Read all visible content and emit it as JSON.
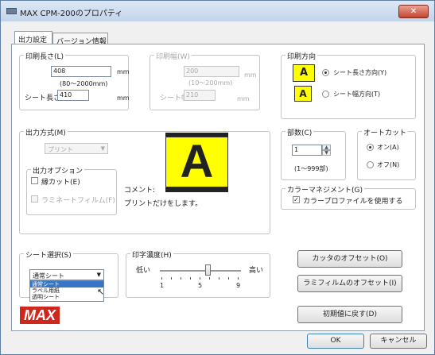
{
  "window": {
    "title": "MAX CPM-200のプロパティ",
    "close_glyph": "✕"
  },
  "tabs": [
    {
      "label": "出力設定",
      "active": true
    },
    {
      "label": "バージョン情報",
      "active": false
    }
  ],
  "print_length": {
    "label": "印刷長さ(L)",
    "value": "408",
    "unit": "mm",
    "range": "(80～2000mm)",
    "sheet_length_label": "シート長さ:",
    "sheet_length_value": "410",
    "sheet_length_unit": "mm"
  },
  "print_width": {
    "label": "印刷幅(W)",
    "value": "200",
    "unit": "mm",
    "range": "(10～200mm)",
    "sheet_width_label": "シート幅:",
    "sheet_width_value": "210",
    "sheet_width_unit": "mm"
  },
  "print_direction": {
    "label": "印刷方向",
    "option_length": "シート長さ方向(Y)",
    "option_width": "シート幅方向(T)",
    "selected": "length"
  },
  "output_method": {
    "label": "出力方式(M)",
    "select_value": "プリント",
    "options_label": "出力オプション",
    "border_cut_label": "縁カット(E)",
    "border_cut_checked": false,
    "laminate_label": "ラミネートフィルム(F)",
    "laminate_checked": false,
    "comment_label": "コメント:",
    "comment_text": "プリントだけをします。",
    "preview_letter": "A"
  },
  "copies": {
    "label": "部数(C)",
    "value": "1",
    "range": "(1～999部)"
  },
  "auto_cut": {
    "label": "オートカット",
    "option_on": "オン(A)",
    "option_off": "オフ(N)",
    "selected": "on"
  },
  "color_management": {
    "label": "カラーマネジメント(G)",
    "use_profile_label": "カラープロファイルを使用する",
    "checked": true
  },
  "sheet_select": {
    "label": "シート選択(S)",
    "current_value": "通常シート",
    "options": [
      "通常シート",
      "ラベル用紙",
      "透明シート"
    ],
    "highlighted_index": 0
  },
  "print_density": {
    "label": "印字濃度(H)",
    "low_label": "低い",
    "high_label": "高い",
    "scale_min": "1",
    "scale_mid": "5",
    "scale_max": "9",
    "value": 6
  },
  "buttons": {
    "cutter_offset": "カッタのオフセット(O)",
    "lamifilm_offset": "ラミフィルムのオフセット(I)",
    "reset_defaults": "初期値に戻す(D)",
    "ok": "OK",
    "cancel": "キャンセル"
  },
  "logo": {
    "text": "MAX",
    "color": "#d0271d"
  },
  "colors": {
    "preview_bg": "#ffff00",
    "selection": "#3975c6"
  }
}
